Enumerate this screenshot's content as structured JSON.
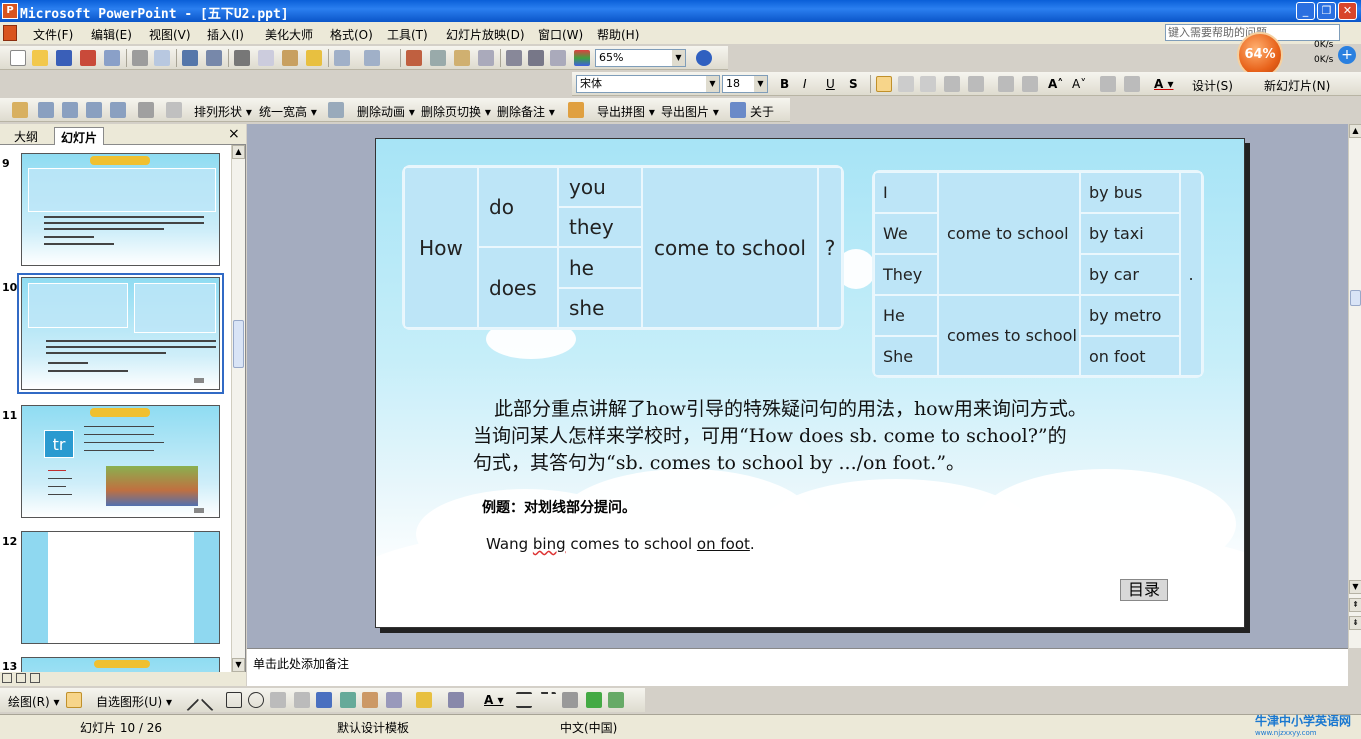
{
  "window": {
    "title": "Microsoft PowerPoint - [五下U2.ppt]",
    "minimize": "_",
    "restore": "❐",
    "close": "✕"
  },
  "menu": [
    "文件(F)",
    "编辑(E)",
    "视图(V)",
    "插入(I)",
    "美化大师",
    "格式(O)",
    "工具(T)",
    "幻灯片放映(D)",
    "窗口(W)",
    "帮助(H)"
  ],
  "help_placeholder": "键入需要帮助的问题",
  "network": {
    "percent": "64%",
    "up": "0K/s",
    "down": "0K/s"
  },
  "toolbar": {
    "zoom": "65%",
    "font": "宋体",
    "size": "18",
    "design": "设计(S)",
    "new_slide": "新幻灯片(N)"
  },
  "toolbar3": [
    "排列形状",
    "统一宽高",
    "删除动画",
    "删除页切换",
    "删除备注",
    "导出拼图",
    "导出图片",
    "关于"
  ],
  "left_pane": {
    "tab_outline": "大纲",
    "tab_slides": "幻灯片",
    "close": "×",
    "slides": [
      {
        "num": "9"
      },
      {
        "num": "10"
      },
      {
        "num": "11",
        "thumb_text": "tr"
      },
      {
        "num": "12"
      },
      {
        "num": "13"
      }
    ]
  },
  "slide": {
    "table1": {
      "how": "How",
      "do": "do",
      "does": "does",
      "you": "you",
      "they": "they",
      "he": "he",
      "she": "she",
      "verb": "come to school",
      "q": "?"
    },
    "table2": {
      "subjects": [
        "I",
        "We",
        "They",
        "He",
        "She"
      ],
      "verb1": "come to school",
      "verb2": "comes to school",
      "ways": [
        "by bus",
        "by taxi",
        "by car",
        "by metro",
        "on foot"
      ],
      "dot": "."
    },
    "explain": [
      "此部分重点讲解了how引导的特殊疑问句的用法，how用来询问方式。",
      "当询问某人怎样来学校时，可用“How does sb. come to school?”的",
      "句式，其答句为“sb. comes to school by .../on foot.”。"
    ],
    "example_heading": "例题：对划线部分提问。",
    "example_prefix": "Wang ",
    "example_name": "bing",
    "example_mid": " comes to school ",
    "example_ul": "on foot",
    "example_end": ".",
    "menu_button": "目录"
  },
  "notes_placeholder": "单击此处添加备注",
  "drawbar": {
    "draw": "绘图(R)",
    "autoshapes": "自选图形(U)"
  },
  "status": {
    "slide": "幻灯片 10 / 26",
    "template": "默认设计模板",
    "lang": "中文(中国)"
  },
  "watermark": {
    "main": "牛津中小学英语网",
    "sub": "www.njzxxyy.com"
  }
}
